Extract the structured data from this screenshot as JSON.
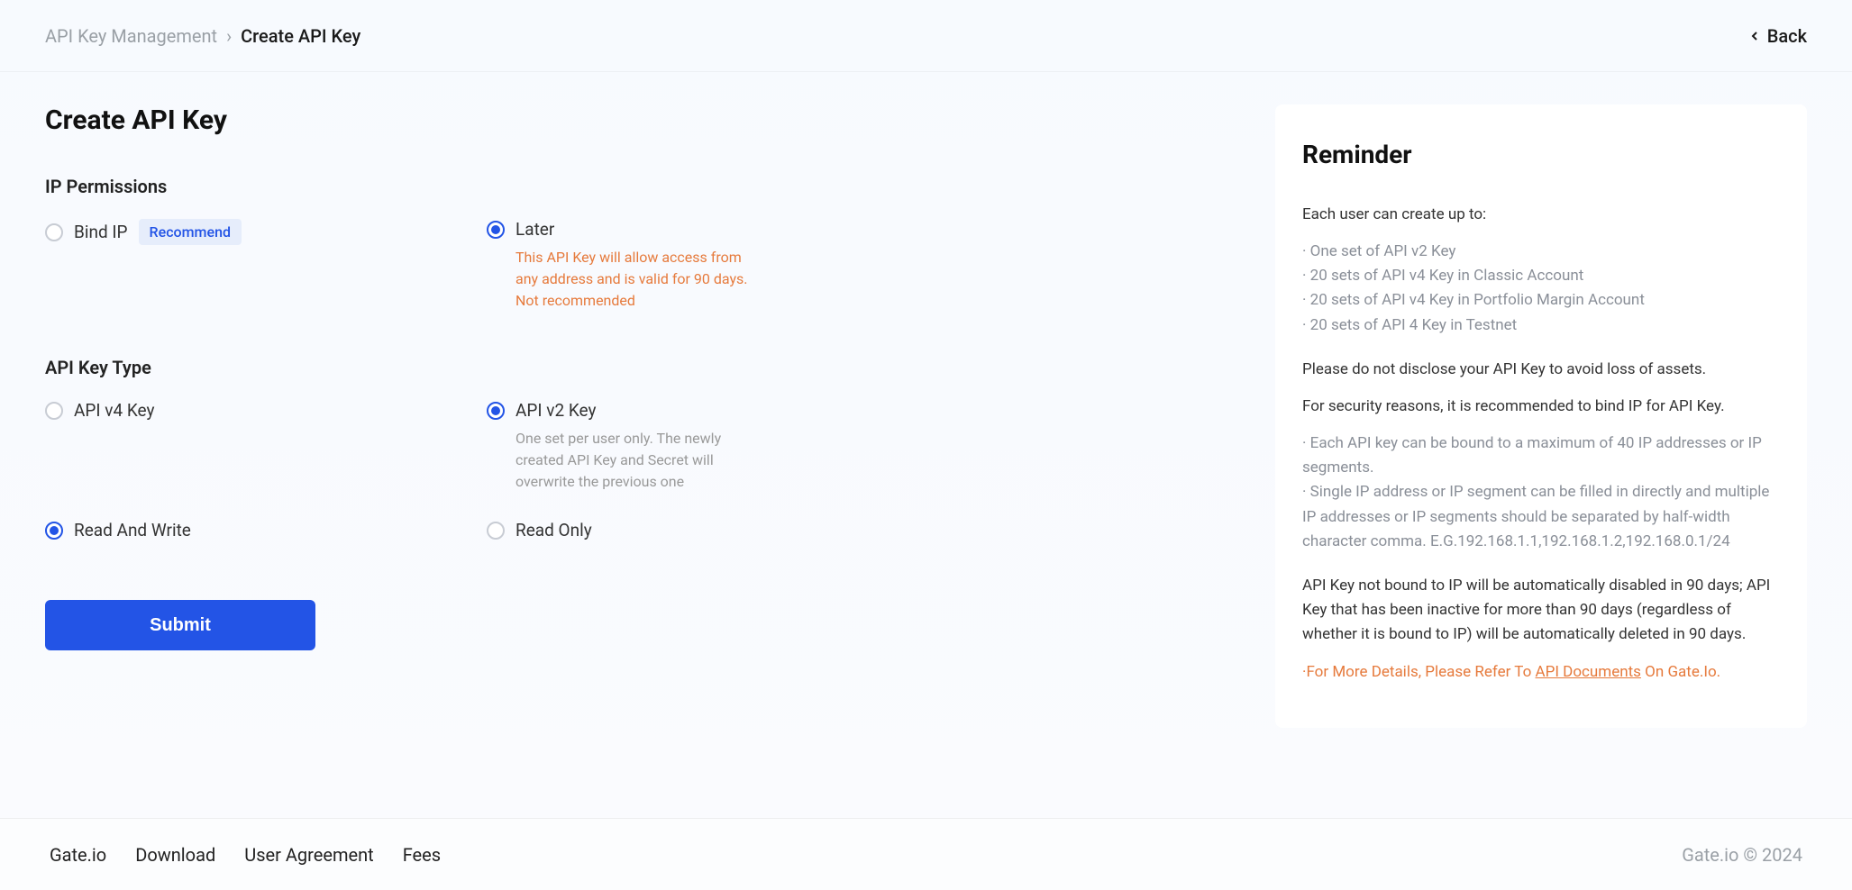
{
  "breadcrumb": {
    "parent": "API Key Management",
    "current": "Create API Key"
  },
  "back_label": "Back",
  "page_title": "Create API Key",
  "sections": {
    "ip_permissions": {
      "title": "IP Permissions",
      "bind_ip": {
        "label": "Bind IP",
        "badge": "Recommend",
        "selected": false
      },
      "later": {
        "label": "Later",
        "selected": true,
        "note": "This API Key will allow access from any address and is valid for 90 days. Not recommended"
      }
    },
    "api_key_type": {
      "title": "API Key Type",
      "v4": {
        "label": "API v4 Key",
        "selected": false
      },
      "v2": {
        "label": "API v2 Key",
        "selected": true,
        "note": "One set per user only. The newly created API Key and Secret will overwrite the previous one"
      },
      "rw": {
        "label": "Read And Write",
        "selected": true
      },
      "ro": {
        "label": "Read Only",
        "selected": false
      }
    }
  },
  "submit_label": "Submit",
  "reminder": {
    "title": "Reminder",
    "intro": "Each user can create up to:",
    "limits": [
      "· One set of API v2 Key",
      "· 20 sets of API v4 Key in Classic Account",
      "· 20 sets of API v4 Key in Portfolio Margin Account",
      "· 20 sets of API 4 Key in Testnet"
    ],
    "disclose": "Please do not disclose your API Key to avoid loss of assets.",
    "security": "For security reasons, it is recommended to bind IP for API Key.",
    "ip_rules": [
      "· Each API key can be bound to a maximum of 40 IP addresses or IP segments.",
      "· Single IP address or IP segment can be filled in directly and multiple IP addresses or IP segments should be separated by half-width character comma. E.G.192.168.1.1,192.168.1.2,192.168.0.1/24"
    ],
    "expiry": "API Key not bound to IP will be automatically disabled in 90 days; API Key that has been inactive for more than 90 days (regardless of whether it is bound to IP) will be automatically deleted in 90 days.",
    "more_prefix": "·For More Details, Please Refer To ",
    "more_link": "API Documents",
    "more_suffix": " On Gate.Io."
  },
  "footer": {
    "links": [
      "Gate.io",
      "Download",
      "User Agreement",
      "Fees"
    ],
    "copyright": "Gate.io © 2024"
  }
}
